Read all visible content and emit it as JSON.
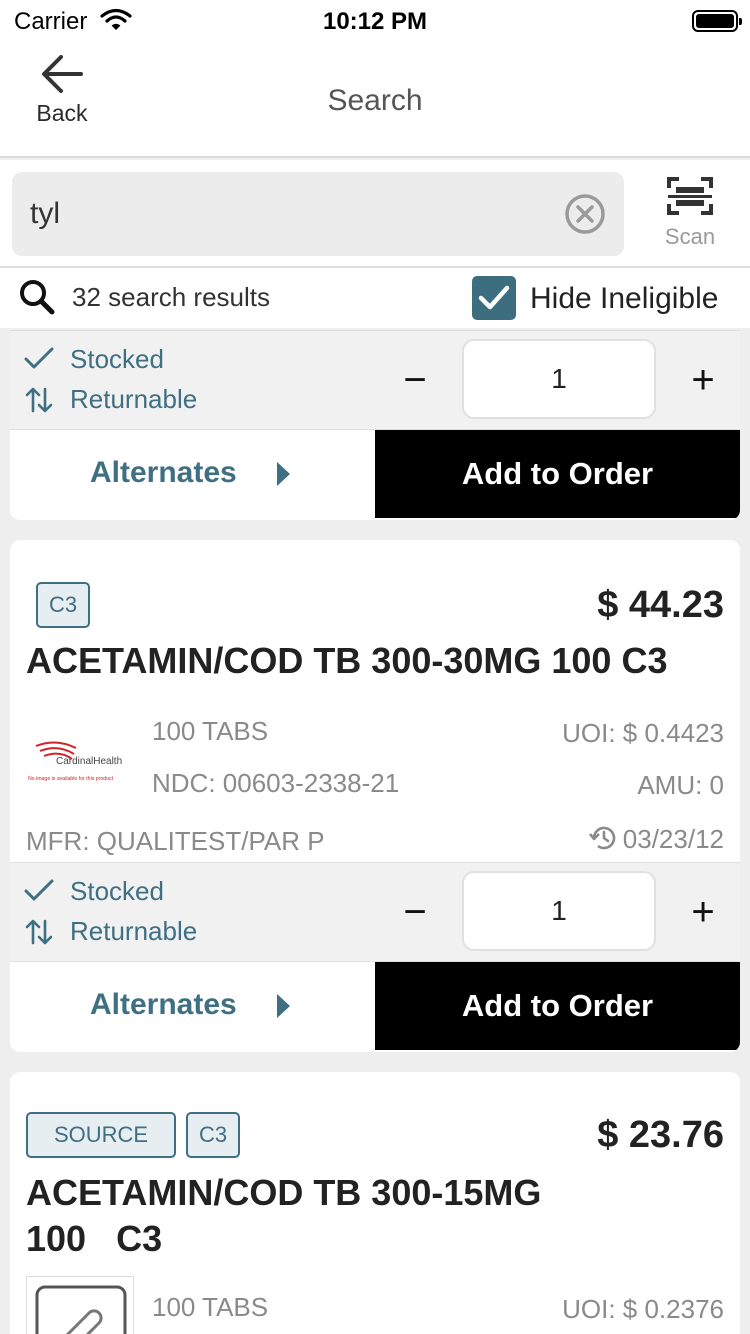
{
  "status": {
    "carrier": "Carrier",
    "time": "10:12 PM"
  },
  "nav": {
    "back_label": "Back",
    "title": "Search"
  },
  "search": {
    "value": "tyl",
    "scan_label": "Scan"
  },
  "results": {
    "count_text": "32 search results",
    "hide_label": "Hide Ineligible",
    "hide_checked": true
  },
  "labels": {
    "stocked": "Stocked",
    "returnable": "Returnable",
    "alternates": "Alternates",
    "add_to_order": "Add to Order",
    "minus": "−",
    "plus": "+"
  },
  "top_card": {
    "qty": "1"
  },
  "products": [
    {
      "badges": [
        "C3"
      ],
      "price": "$ 44.23",
      "name": "ACETAMIN/COD TB 300-30MG 100 C3",
      "pack": "100 TABS",
      "ndc": "NDC: 00603-2338-21",
      "uoi": "UOI: $ 0.4423",
      "amu": "AMU: 0",
      "mfr": "MFR: QUALITEST/PAR P",
      "last_date": "03/23/12",
      "qty": "1",
      "image_brand": "CardinalHealth",
      "image_note": "No image is available for this product"
    },
    {
      "badges": [
        "SOURCE",
        "C3"
      ],
      "price": "$ 23.76",
      "name_line1": "ACETAMIN/COD TB 300-15MG",
      "name_line2": "100   C3",
      "pack": "100 TABS",
      "uoi": "UOI: $ 0.2376"
    }
  ],
  "colors": {
    "accent": "#3f6f82",
    "button_black": "#000000",
    "background": "#eeeeee"
  }
}
